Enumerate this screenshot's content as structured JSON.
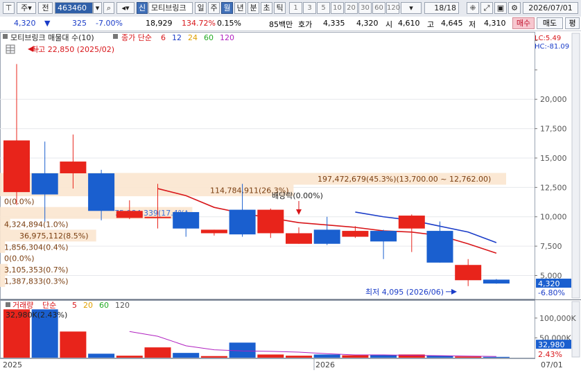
{
  "toolbar": {
    "menu_label": "주",
    "prev_label": "전",
    "stock_code": "463460",
    "tag_label": "신",
    "stock_name": "모티브링크",
    "periods": [
      "일",
      "주",
      "월",
      "년",
      "분",
      "초",
      "틱"
    ],
    "selected_period": "월",
    "intervals": [
      "1",
      "3",
      "5",
      "10",
      "20",
      "30",
      "60",
      "120"
    ],
    "page_counter": "18/18",
    "date": "2026/07/01"
  },
  "quote": {
    "price": "4,320",
    "arrow": "▼",
    "change": "325",
    "change_pct": "-7.00%",
    "volume": "18,929",
    "volume_ratio": "134.72%",
    "turnover": "0.15%",
    "amount": "85백만",
    "ask_label": "호가",
    "ask": "4,335",
    "bid": "4,320",
    "open_label": "시",
    "open": "4,610",
    "high_label": "고",
    "high": "4,645",
    "low_label": "저",
    "low": "4,310",
    "buy_label": "매수",
    "sell_label": "매도",
    "eval_label": "평"
  },
  "chart_header": {
    "title": "모티브링크 매물대 수(10)",
    "ma_label": "종가 단순",
    "ma_periods": [
      "6",
      "12",
      "24",
      "60",
      "120"
    ],
    "ma_colors": [
      "#d8161a",
      "#1a3cc8",
      "#e0a000",
      "#22aa22",
      "#b020c0"
    ],
    "lc": "LC:5.49",
    "hc": "HC:-81.09"
  },
  "chart_data": {
    "type": "candlestick",
    "y_ticks": [
      "20,000",
      "17,500",
      "15,000",
      "12,500",
      "10,000",
      "7,500",
      "5,000"
    ],
    "ylim": [
      3200,
      25500
    ],
    "x_labels": [
      "2025",
      "2026"
    ],
    "last_date_label": "07/01",
    "candles": [
      {
        "o": 12100,
        "h": 23000,
        "l": 11000,
        "c": 16500
      },
      {
        "o": 13700,
        "h": 16400,
        "l": 9600,
        "c": 11900
      },
      {
        "o": 13700,
        "h": 17000,
        "l": 12400,
        "c": 14700
      },
      {
        "o": 13700,
        "h": 14000,
        "l": 9700,
        "c": 10500
      },
      {
        "o": 9900,
        "h": 11400,
        "l": 9800,
        "c": 10500
      },
      {
        "o": 10000,
        "h": 12800,
        "l": 9000,
        "c": 10000
      },
      {
        "o": 10400,
        "h": 10500,
        "l": 8300,
        "c": 9000
      },
      {
        "o": 8600,
        "h": 8900,
        "l": 8400,
        "c": 8900
      },
      {
        "o": 10600,
        "h": 12800,
        "l": 8300,
        "c": 8500
      },
      {
        "o": 8600,
        "h": 10700,
        "l": 8200,
        "c": 10600
      },
      {
        "o": 7700,
        "h": 9100,
        "l": 7700,
        "c": 8600
      },
      {
        "o": 8900,
        "h": 10000,
        "l": 7600,
        "c": 7700
      },
      {
        "o": 8300,
        "h": 9200,
        "l": 8200,
        "c": 8800
      },
      {
        "o": 8800,
        "h": 8900,
        "l": 6400,
        "c": 7900
      },
      {
        "o": 9000,
        "h": 10200,
        "l": 7000,
        "c": 10100
      },
      {
        "o": 8800,
        "h": 9600,
        "l": 6100,
        "c": 6100
      },
      {
        "o": 4600,
        "h": 6400,
        "l": 4100,
        "c": 5900
      },
      {
        "o": 4650,
        "h": 4700,
        "l": 4300,
        "c": 4320
      }
    ],
    "ma6_red": [
      null,
      null,
      null,
      null,
      null,
      12400,
      11800,
      10800,
      10300,
      9900,
      9500,
      9300,
      9100,
      8800,
      8700,
      8400,
      7700,
      6900
    ],
    "ma12_blue": [
      null,
      null,
      null,
      null,
      null,
      null,
      null,
      null,
      null,
      null,
      null,
      null,
      10400,
      10000,
      9700,
      9200,
      8700,
      7800
    ],
    "volume_ticks": [
      "100,000K",
      "50,000K"
    ],
    "volume_ylim": [
      0,
      140000
    ],
    "volume": [
      122000,
      122000,
      66000,
      10000,
      5000,
      26000,
      12000,
      4000,
      38000,
      8000,
      5000,
      8000,
      6000,
      7000,
      8000,
      5000,
      3000,
      2000
    ],
    "volume_ma": [
      null,
      null,
      null,
      null,
      66000,
      54000,
      30000,
      20000,
      17000,
      16000,
      14000,
      10000,
      7000,
      7000,
      6000,
      5000,
      4000,
      3000
    ],
    "volume_header": {
      "label": "거래량",
      "ma_label": "단순",
      "ma_periods": [
        "5",
        "20",
        "60",
        "120"
      ],
      "ma_colors": [
        "#d8161a",
        "#e0a000",
        "#22aa22",
        "#555555"
      ],
      "top_value": "32,980K(2.43%)"
    },
    "price_tag": "4,320",
    "price_tag_pct": "-6.80%",
    "volume_tag": "32,980",
    "volume_tag_pct": "2.43%",
    "volume_profile": [
      {
        "label": "197,472,679(45.3%)(13,700.00 ~ 12,762.00)",
        "price": 13230,
        "width_pct": 100
      },
      {
        "label": "114,784,911(26.3%)",
        "price": 12250,
        "width_pct": 58
      },
      {
        "label": "0(0.0%)",
        "price": 11300,
        "width_pct": 0
      },
      {
        "label": "75,984,339(17.4%)",
        "price": 10330,
        "width_pct": 38
      },
      {
        "label": "4,324,894(1.0%)",
        "price": 9360,
        "width_pct": 2
      },
      {
        "label": "36,975,112(8.5%)",
        "price": 8400,
        "width_pct": 19
      },
      {
        "label": "1,856,304(0.4%)",
        "price": 7430,
        "width_pct": 1
      },
      {
        "label": "0(0.0%)",
        "price": 6460,
        "width_pct": 0
      },
      {
        "label": "3,105,353(0.7%)",
        "price": 5490,
        "width_pct": 1.5
      },
      {
        "label": "1,387,833(0.3%)",
        "price": 4530,
        "width_pct": 1
      }
    ],
    "annotations": {
      "high": "최고 22,850 (2025/02)",
      "low": "최저 4,095 (2026/06)",
      "dividend": "배당락(0.00%)"
    }
  }
}
